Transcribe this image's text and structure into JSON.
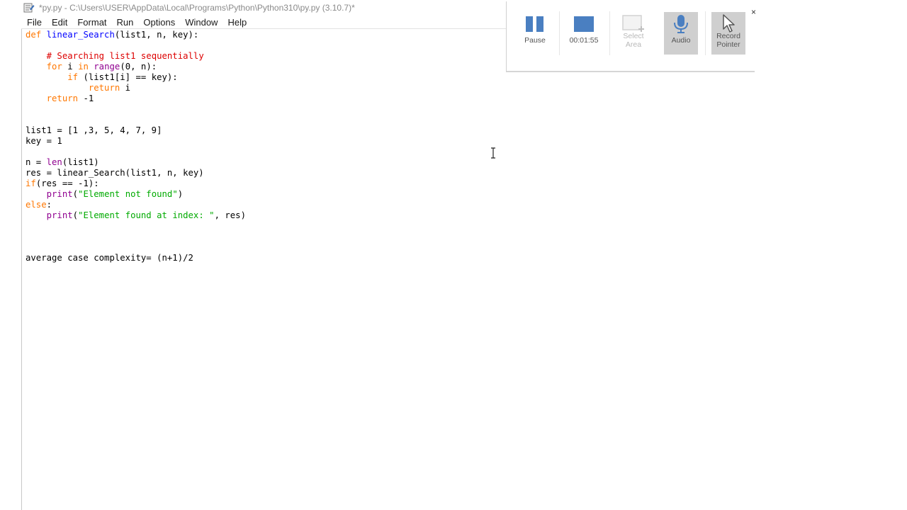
{
  "window": {
    "title": "*py.py - C:\\Users\\USER\\AppData\\Local\\Programs\\Python\\Python310\\py.py (3.10.7)*"
  },
  "menu": [
    "File",
    "Edit",
    "Format",
    "Run",
    "Options",
    "Window",
    "Help"
  ],
  "editor": {
    "lines": [
      [
        {
          "t": "def",
          "c": "kw"
        },
        {
          "t": " "
        },
        {
          "t": "linear_Search",
          "c": "fn"
        },
        {
          "t": "(list1, n, key):"
        }
      ],
      [],
      [
        {
          "t": "    "
        },
        {
          "t": "# Searching list1 sequentially",
          "c": "cm"
        }
      ],
      [
        {
          "t": "    "
        },
        {
          "t": "for",
          "c": "kw"
        },
        {
          "t": " i "
        },
        {
          "t": "in",
          "c": "kw"
        },
        {
          "t": " "
        },
        {
          "t": "range",
          "c": "bi"
        },
        {
          "t": "(0, n):"
        }
      ],
      [
        {
          "t": "        "
        },
        {
          "t": "if",
          "c": "kw"
        },
        {
          "t": " (list1[i] == key):"
        }
      ],
      [
        {
          "t": "            "
        },
        {
          "t": "return",
          "c": "kw"
        },
        {
          "t": " i"
        }
      ],
      [
        {
          "t": "    "
        },
        {
          "t": "return",
          "c": "kw"
        },
        {
          "t": " -1"
        }
      ],
      [],
      [],
      [
        {
          "t": "list1 = [1 ,3, 5, 4, 7, 9]"
        }
      ],
      [
        {
          "t": "key = 1"
        }
      ],
      [],
      [
        {
          "t": "n = "
        },
        {
          "t": "len",
          "c": "bi"
        },
        {
          "t": "(list1)"
        }
      ],
      [
        {
          "t": "res = linear_Search(list1, n, key)"
        }
      ],
      [
        {
          "t": "if",
          "c": "kw"
        },
        {
          "t": "(res == -1):"
        }
      ],
      [
        {
          "t": "    "
        },
        {
          "t": "print",
          "c": "bi"
        },
        {
          "t": "("
        },
        {
          "t": "\"Element not found\"",
          "c": "st"
        },
        {
          "t": ")"
        }
      ],
      [
        {
          "t": "else",
          "c": "kw"
        },
        {
          "t": ":"
        }
      ],
      [
        {
          "t": "    "
        },
        {
          "t": "print",
          "c": "bi"
        },
        {
          "t": "("
        },
        {
          "t": "\"Element found at index: \"",
          "c": "st"
        },
        {
          "t": ", res)"
        }
      ],
      [],
      [],
      [],
      [
        {
          "t": "average case complexity= (n+1)/2"
        }
      ]
    ]
  },
  "recorder": {
    "pause_label": "Pause",
    "timer": "00:01:55",
    "select_area_label_1": "Select",
    "select_area_label_2": "Area",
    "audio_label": "Audio",
    "record_pointer_label_1": "Record",
    "record_pointer_label_2": "Pointer",
    "accent_color": "#4a7fc1",
    "close_glyph": "×"
  },
  "icons": {
    "app": "idle-file-icon",
    "pause": "pause-icon",
    "stop": "stop-icon",
    "select_area": "select-area-icon",
    "audio": "microphone-icon",
    "pointer": "pointer-icon",
    "cursor": "text-cursor-icon"
  }
}
